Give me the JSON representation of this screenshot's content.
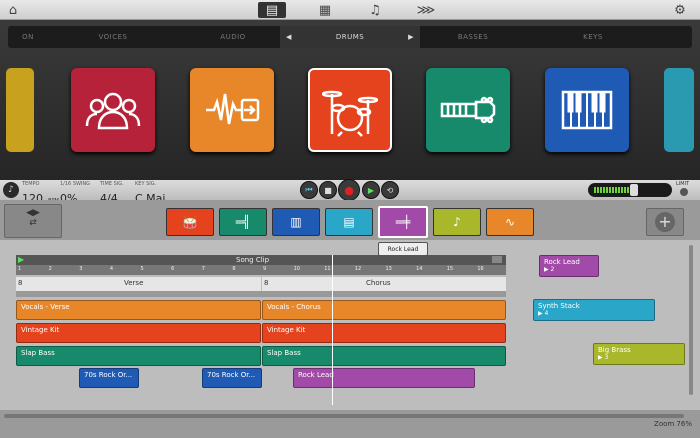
{
  "toolbar": {
    "icons": [
      "home-icon",
      "browser-icon",
      "mixer-icon",
      "notes-icon",
      "arrange-icon",
      "settings-icon"
    ]
  },
  "browser": {
    "categories": [
      "ON",
      "VOICES",
      "AUDIO",
      "DRUMS",
      "BASSES",
      "KEYS"
    ],
    "active_category": "DRUMS",
    "prev_label": "◀",
    "next_label": "▶",
    "tiles": [
      {
        "name": "voices",
        "color": "#b5223a"
      },
      {
        "name": "audio",
        "color": "#e8862a"
      },
      {
        "name": "drums",
        "color": "#e5431e"
      },
      {
        "name": "basses",
        "color": "#168a6a"
      },
      {
        "name": "keys",
        "color": "#1f5bb5"
      }
    ]
  },
  "transport": {
    "tempo_label": "TEMPO",
    "tempo_value": "120",
    "tempo_unit": "BPM",
    "swing_label": "1/16 SWING",
    "swing_value": "0%",
    "timesig_label": "TIME SIG.",
    "timesig_value": "4/4",
    "keysig_label": "KEY SIG.",
    "keysig_value": "C Maj.",
    "limit_label": "LIMIT"
  },
  "tracks_header": {
    "tooltip": "Rock Lead",
    "instruments": [
      {
        "name": "drums",
        "color": "#e5431e"
      },
      {
        "name": "bass",
        "color": "#168a6a"
      },
      {
        "name": "keys",
        "color": "#1f5bb5"
      },
      {
        "name": "synth",
        "color": "#2aa6c8"
      },
      {
        "name": "guitar",
        "color": "#a24aa8"
      },
      {
        "name": "brass",
        "color": "#a8b82a"
      },
      {
        "name": "audio",
        "color": "#e8862a"
      }
    ]
  },
  "arranger": {
    "song_clip_label": "Song Clip",
    "ruler": [
      "1",
      "2",
      "3",
      "4",
      "5",
      "6",
      "7",
      "8",
      "9",
      "10",
      "11",
      "12",
      "13",
      "14",
      "15",
      "16"
    ],
    "sections": [
      {
        "num": "8",
        "name": "Verse"
      },
      {
        "num": "8",
        "name": "Chorus"
      }
    ],
    "clips": [
      {
        "label": "Vocals - Verse",
        "color": "#e8862a"
      },
      {
        "label": "Vocals - Chorus",
        "color": "#e8862a"
      },
      {
        "label": "Vintage Kit",
        "color": "#e5431e"
      },
      {
        "label": "Vintage Kit",
        "color": "#e5431e"
      },
      {
        "label": "Slap Bass",
        "color": "#168a6a"
      },
      {
        "label": "Slap Bass",
        "color": "#168a6a"
      },
      {
        "label": "70s Rock Or...",
        "color": "#1f5bb5"
      },
      {
        "label": "70s Rock Or...",
        "color": "#1f5bb5"
      },
      {
        "label": "Rock Lead",
        "color": "#a24aa8"
      }
    ],
    "side_clips": [
      {
        "label": "Rock Lead",
        "count": "2",
        "color": "#a24aa8"
      },
      {
        "label": "Synth Stack",
        "count": "4",
        "color": "#2aa6c8"
      },
      {
        "label": "Big Brass",
        "count": "3",
        "color": "#a8b82a"
      }
    ],
    "zoom_label": "Zoom 76%"
  }
}
